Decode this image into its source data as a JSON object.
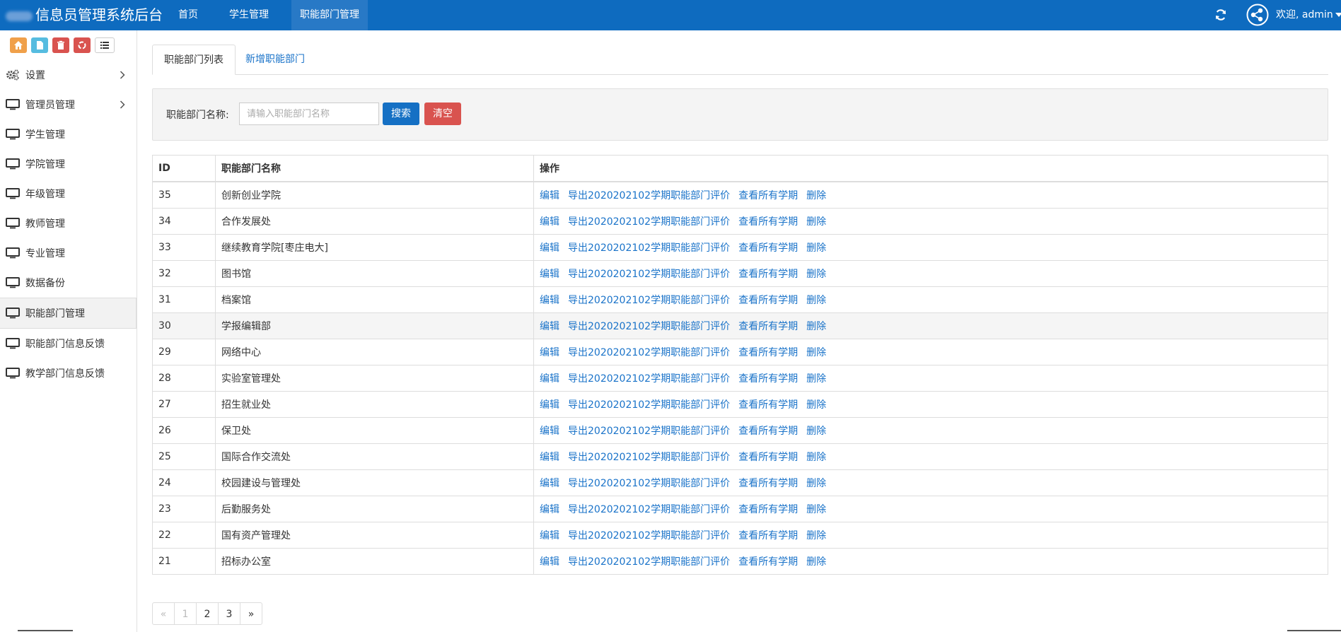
{
  "header": {
    "brand": "信息员管理系统后台",
    "nav": [
      "首页",
      "学生管理",
      "职能部门管理"
    ],
    "welcome": "欢迎, admin"
  },
  "icons": {
    "refresh": "refresh-icon",
    "avatar": "share-network-avatar-icon",
    "shortcuts": [
      "home-icon",
      "file-icon",
      "trash-icon",
      "recycle-icon",
      "list-icon"
    ],
    "menu": "monitor-icon",
    "settings": "gears-icon"
  },
  "colors": {
    "navbar": "#0e6bbf",
    "primary": "#1570c4",
    "danger": "#d9534f",
    "link": "#1a73c9"
  },
  "sidebar": {
    "items": [
      {
        "label": "设置",
        "has_children": true
      },
      {
        "label": "管理员管理",
        "has_children": true
      },
      {
        "label": "学生管理"
      },
      {
        "label": "学院管理"
      },
      {
        "label": "年级管理"
      },
      {
        "label": "教师管理"
      },
      {
        "label": "专业管理"
      },
      {
        "label": "数据备份"
      },
      {
        "label": "职能部门管理",
        "active": true
      },
      {
        "label": "职能部门信息反馈"
      },
      {
        "label": "教学部门信息反馈"
      }
    ]
  },
  "tabs": {
    "list": "职能部门列表",
    "add": "新增职能部门"
  },
  "search": {
    "label": "职能部门名称:",
    "placeholder": "请输入职能部门名称",
    "value": "",
    "search_button": "搜索",
    "clear_button": "清空"
  },
  "table": {
    "headers": [
      "ID",
      "职能部门名称",
      "操作"
    ],
    "actions": [
      "编辑",
      "导出2020202102学期职能部门评价",
      "查看所有学期",
      "删除"
    ],
    "rows": [
      {
        "id": "35",
        "name": "创新创业学院"
      },
      {
        "id": "34",
        "name": "合作发展处"
      },
      {
        "id": "33",
        "name": "继续教育学院[枣庄电大]"
      },
      {
        "id": "32",
        "name": "图书馆"
      },
      {
        "id": "31",
        "name": "档案馆"
      },
      {
        "id": "30",
        "name": "学报编辑部"
      },
      {
        "id": "29",
        "name": "网络中心"
      },
      {
        "id": "28",
        "name": "实验室管理处"
      },
      {
        "id": "27",
        "name": "招生就业处"
      },
      {
        "id": "26",
        "name": "保卫处"
      },
      {
        "id": "25",
        "name": "国际合作交流处"
      },
      {
        "id": "24",
        "name": "校园建设与管理处"
      },
      {
        "id": "23",
        "name": "后勤服务处"
      },
      {
        "id": "22",
        "name": "国有资产管理处"
      },
      {
        "id": "21",
        "name": "招标办公室"
      }
    ],
    "highlighted_row": "30"
  },
  "pagination": {
    "prev": "«",
    "pages": [
      "1",
      "2",
      "3"
    ],
    "current": "1",
    "next": "»"
  }
}
